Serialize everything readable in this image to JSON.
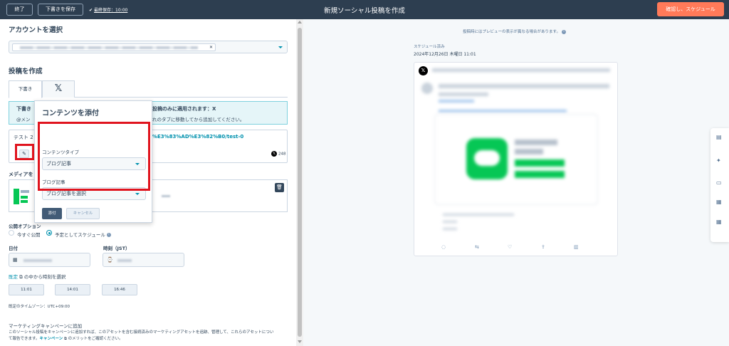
{
  "header": {
    "exit_label": "終了",
    "save_draft_label": "下書きを保存",
    "autosave_label": "最終保存：10:00",
    "title": "新規ソーシャル投稿を作成",
    "confirm_label": "確認し、スケジュール"
  },
  "accounts": {
    "heading": "アカウントを選択"
  },
  "compose": {
    "heading": "投稿を作成",
    "tabs": [
      {
        "label": "下書き",
        "active": true
      },
      {
        "label": "𝕏",
        "active": false
      }
    ],
    "info_line1_left": "下書き",
    "info_line1_right": "投稿のみに適用されます：X",
    "info_line2_left": "@メン",
    "info_line2_right": "れのタブに移動してから追加してください。",
    "editor_text": "テスト 2",
    "editor_link": "%E3%83%AD%E3%82%B0/test-0",
    "char_count": "248",
    "media_label": "メディアを"
  },
  "attach_popup": {
    "title": "コンテンツを添付",
    "content_type_label": "コンテンツタイプ",
    "content_type_value": "ブログ記事",
    "blog_label": "ブログ記事",
    "blog_value": "ブログ記事を選択",
    "attach_label": "添付",
    "cancel_label": "キャンセル"
  },
  "publish": {
    "heading": "公開オプション",
    "option_now": "今すぐ公開",
    "option_schedule": "予定としてスケジュール",
    "selected": "schedule",
    "date_label": "日付",
    "time_label": "時刻（JST）",
    "schedule_link": "既定",
    "schedule_suffix": "の中から時刻を選択",
    "time_slots": [
      "11:01",
      "14:01",
      "16:46"
    ],
    "timezone": "既定のタイムゾーン：UTC+09:00"
  },
  "campaign": {
    "heading": "マーケティングキャンペーンに追加",
    "description_1": "このソーシャル投稿をキャンペーンに追加すれば、このアセットを含む接続済みのマーケティングアセットを追跡、管理して、これらのアセットについ",
    "description_2a": "て報告できます。",
    "description_link": "キャンペーン",
    "description_2b": "のメリットをご確認ください。"
  },
  "preview": {
    "note": "投稿時にはプレビューの表示が異なる場合があります。",
    "status": "スケジュール済み",
    "date": "2024年12月26日 木曜日 11:01"
  },
  "colors": {
    "header_bg": "#2d3e50",
    "accent": "#ff7a59",
    "link": "#0091ae",
    "highlight": "#e0141e",
    "line_green": "#06c755"
  },
  "icons": [
    "check-icon",
    "x-logo-icon",
    "paperclip-icon",
    "trash-icon",
    "calendar-icon",
    "clock-icon",
    "info-icon",
    "external-link-icon",
    "reply-icon",
    "retweet-icon",
    "like-icon",
    "share-icon",
    "stats-icon",
    "sparkle-icon",
    "comment-icon"
  ]
}
